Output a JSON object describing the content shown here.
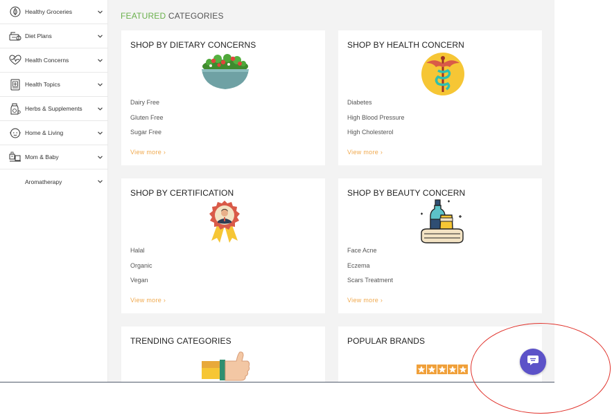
{
  "sidebar": {
    "items": [
      {
        "label": "Healthy Groceries",
        "icon": "leaf-drop-icon"
      },
      {
        "label": "Diet Plans",
        "icon": "scale-icon"
      },
      {
        "label": "Health Concerns",
        "icon": "heart-pulse-icon"
      },
      {
        "label": "Health Topics",
        "icon": "book-icon"
      },
      {
        "label": "Herbs & Supplements",
        "icon": "supplement-bottle-icon"
      },
      {
        "label": "Home & Living",
        "icon": "face-icon"
      },
      {
        "label": "Mom & Baby",
        "icon": "stroller-icon"
      },
      {
        "label": "Aromatherapy",
        "icon": ""
      }
    ]
  },
  "main": {
    "title_highlight": "FEATURED",
    "title_rest": " CATEGORIES",
    "cards": [
      {
        "title": "SHOP BY DIETARY CONCERNS",
        "image": "salad-bowl-icon",
        "links": [
          "Dairy Free",
          "Gluten Free",
          "Sugar Free"
        ],
        "more": "View more ›"
      },
      {
        "title": "SHOP BY HEALTH CONCERN",
        "image": "caduceus-icon",
        "links": [
          "Diabetes",
          "High Blood Pressure",
          "High Cholesterol"
        ],
        "more": "View more ›"
      },
      {
        "title": "SHOP BY CERTIFICATION",
        "image": "award-badge-icon",
        "links": [
          "Halal",
          "Organic",
          "Vegan"
        ],
        "more": "View more ›"
      },
      {
        "title": "SHOP BY BEAUTY CONCERN",
        "image": "cosmetics-icon",
        "links": [
          "Face Acne",
          "Eczema",
          "Scars Treatment"
        ],
        "more": "View more ›"
      },
      {
        "title": "TRENDING CATEGORIES",
        "image": "thumbs-up-icon",
        "links": [],
        "more": ""
      },
      {
        "title": "POPULAR BRANDS",
        "image": "five-stars-icon",
        "links": [],
        "more": ""
      }
    ]
  },
  "chat": {
    "icon": "chat-bubble-icon"
  },
  "colors": {
    "accent_green": "#6ab04c",
    "view_more": "#f0a94e",
    "chat": "#5c52c8",
    "annotation": "#e0312a"
  }
}
